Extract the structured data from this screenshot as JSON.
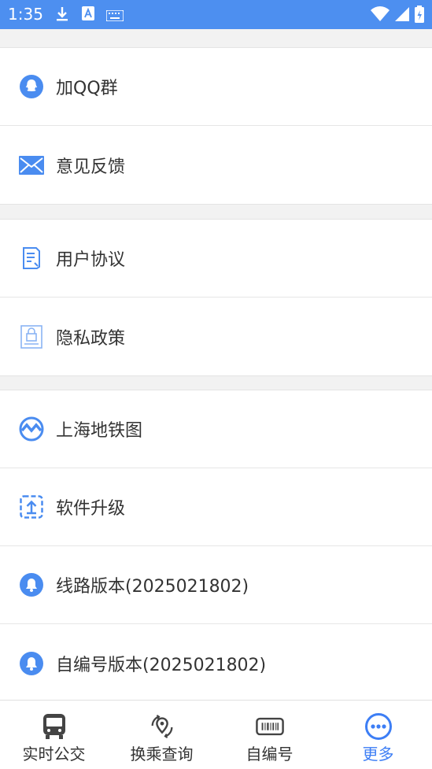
{
  "status_bar": {
    "time": "1:35",
    "icons": [
      "download-icon",
      "a-icon",
      "keyboard-icon",
      "wifi-icon",
      "signal-icon",
      "battery-icon"
    ]
  },
  "colors": {
    "status_bar": "#4d8ff0",
    "accent": "#3d7ef5",
    "icon_blue": "#4a8cf0",
    "text": "#333333"
  },
  "menu": {
    "group1": [
      {
        "label": "加QQ群",
        "icon": "qq-icon"
      },
      {
        "label": "意见反馈",
        "icon": "mail-icon"
      }
    ],
    "group2": [
      {
        "label": "用户协议",
        "icon": "document-icon"
      },
      {
        "label": "隐私政策",
        "icon": "lock-document-icon"
      }
    ],
    "group3": [
      {
        "label": "上海地铁图",
        "icon": "metro-logo-icon"
      },
      {
        "label": "软件升级",
        "icon": "upgrade-icon"
      },
      {
        "label": "线路版本(2025021802)",
        "icon": "bell-icon"
      },
      {
        "label": "自编号版本(2025021802)",
        "icon": "bell-icon"
      }
    ]
  },
  "tabbar": {
    "active_index": 3,
    "tabs": [
      {
        "label": "实时公交",
        "icon": "bus-icon"
      },
      {
        "label": "换乘查询",
        "icon": "transfer-location-icon"
      },
      {
        "label": "自编号",
        "icon": "barcode-icon"
      },
      {
        "label": "更多",
        "icon": "more-icon"
      }
    ]
  }
}
